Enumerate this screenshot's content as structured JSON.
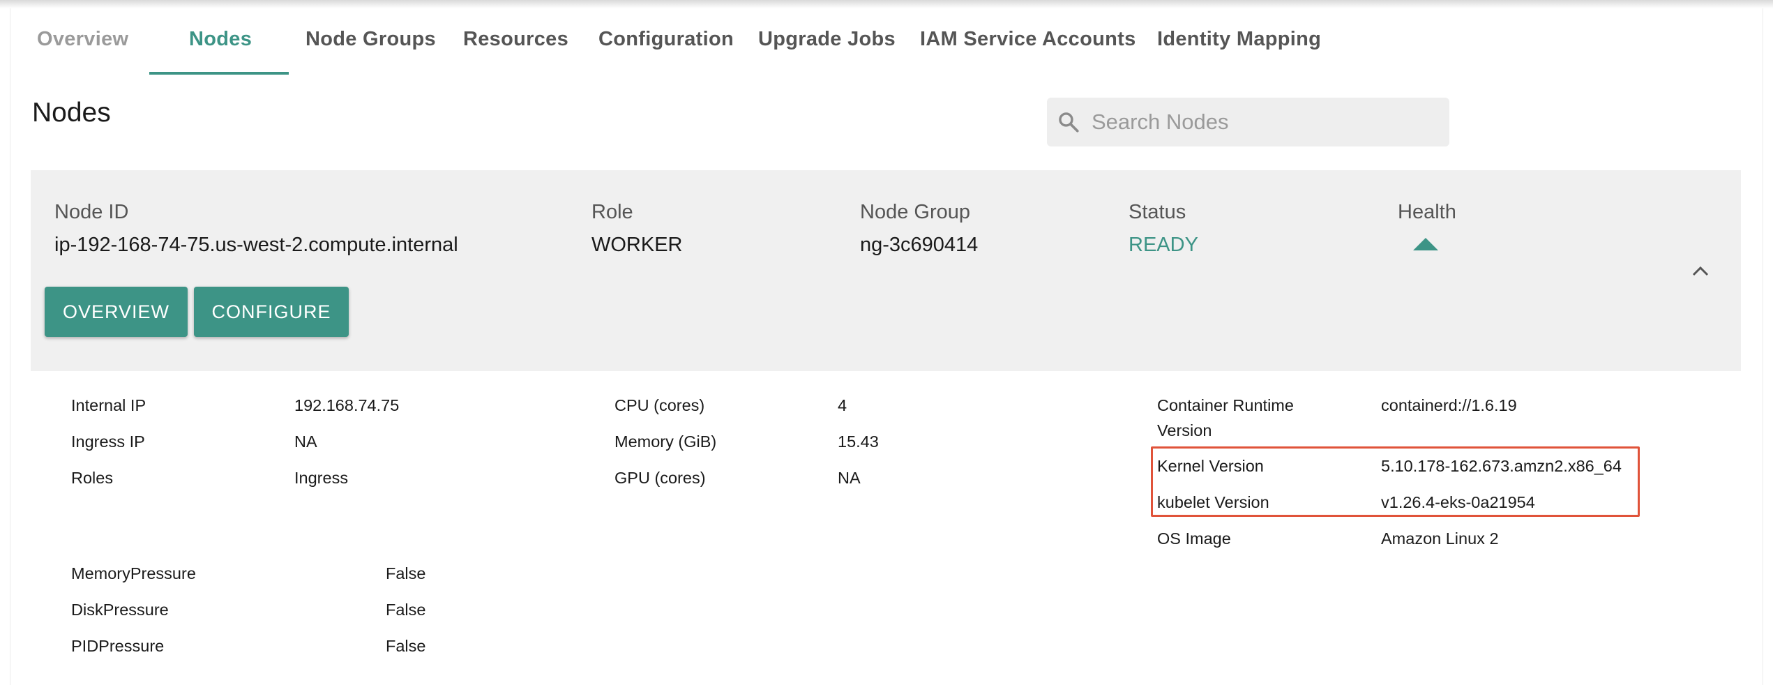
{
  "tabs": [
    {
      "label": "Overview"
    },
    {
      "label": "Nodes"
    },
    {
      "label": "Node Groups"
    },
    {
      "label": "Resources"
    },
    {
      "label": "Configuration"
    },
    {
      "label": "Upgrade Jobs"
    },
    {
      "label": "IAM Service Accounts"
    },
    {
      "label": "Identity Mapping"
    }
  ],
  "active_tab": "Nodes",
  "page_title": "Nodes",
  "search": {
    "placeholder": "Search Nodes"
  },
  "node": {
    "node_id_label": "Node ID",
    "node_id": "ip-192-168-74-75.us-west-2.compute.internal",
    "role_label": "Role",
    "role": "WORKER",
    "node_group_label": "Node Group",
    "node_group": "ng-3c690414",
    "status_label": "Status",
    "status": "READY",
    "health_label": "Health",
    "health_icon": "triangle-up-icon"
  },
  "buttons": {
    "overview": "OVERVIEW",
    "configure": "CONFIGURE"
  },
  "details": {
    "col1": [
      {
        "label": "Internal IP",
        "value": "192.168.74.75"
      },
      {
        "label": "Ingress IP",
        "value": "NA"
      },
      {
        "label": "Roles",
        "value": "Ingress"
      }
    ],
    "col2": [
      {
        "label": "CPU (cores)",
        "value": "4"
      },
      {
        "label": "Memory (GiB)",
        "value": "15.43"
      },
      {
        "label": "GPU (cores)",
        "value": "NA"
      }
    ],
    "col3": [
      {
        "label": "Container Runtime Version",
        "value": "containerd://1.6.19"
      },
      {
        "label": "Kernel Version",
        "value": "5.10.178-162.673.amzn2.x86_64"
      },
      {
        "label": "kubelet Version",
        "value": "v1.26.4-eks-0a21954"
      },
      {
        "label": "OS Image",
        "value": "Amazon Linux 2"
      }
    ],
    "conditions": [
      {
        "label": "MemoryPressure",
        "value": "False"
      },
      {
        "label": "DiskPressure",
        "value": "False"
      },
      {
        "label": "PIDPressure",
        "value": "False"
      }
    ]
  },
  "colors": {
    "accent": "#3d9486",
    "highlight": "#e0533a",
    "card_bg": "#f0f0f0"
  }
}
